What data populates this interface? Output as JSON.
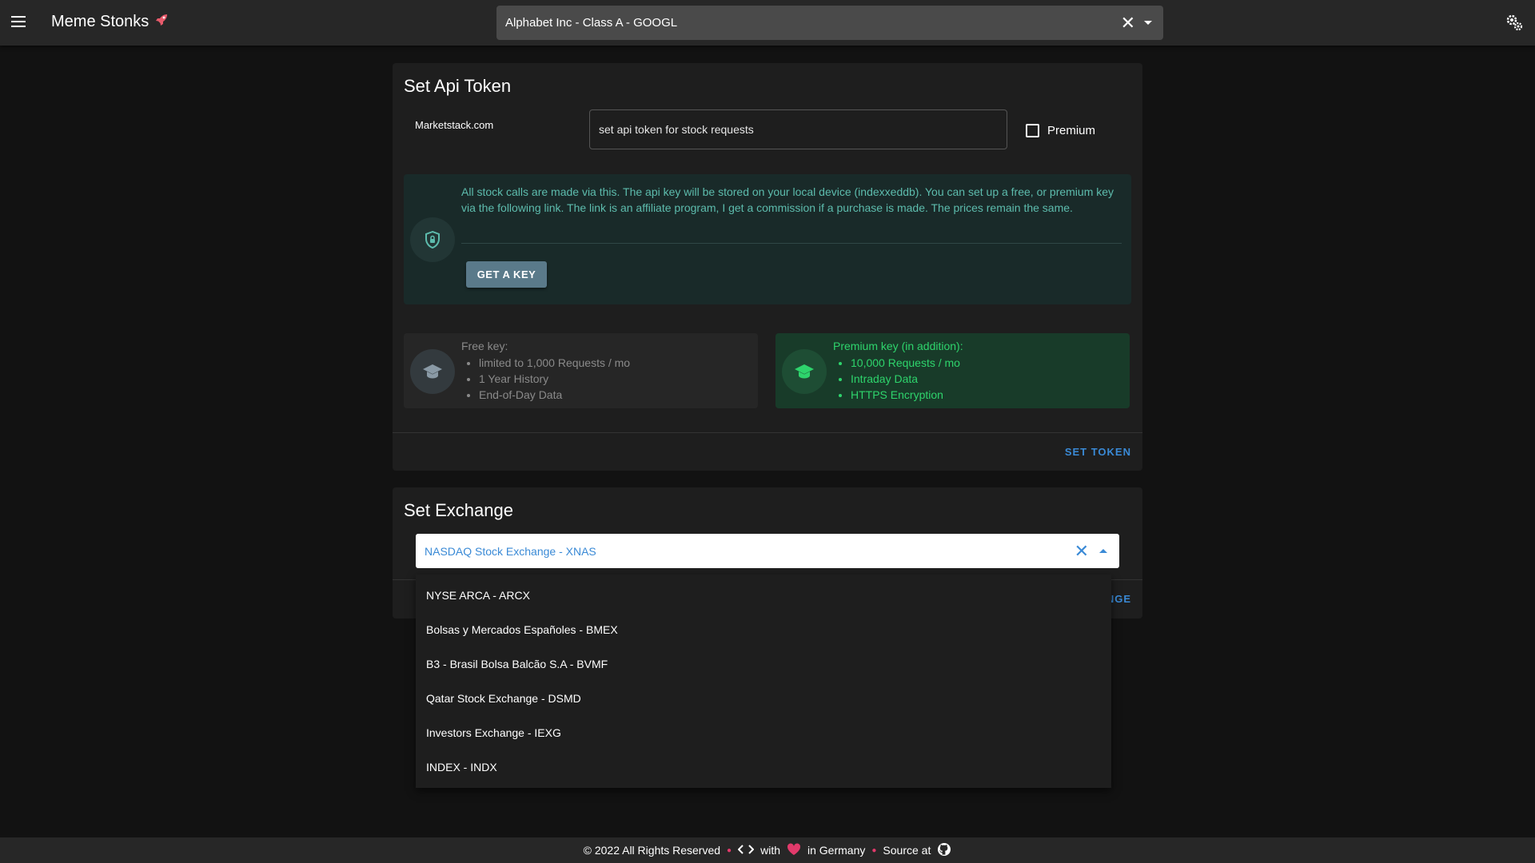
{
  "appbar": {
    "title": "Meme Stonks",
    "stock_select_value": "Alphabet Inc - Class A - GOOGL"
  },
  "api_card": {
    "title": "Set Api Token",
    "provider_label": "Marketstack.com",
    "token_placeholder": "set api token for stock requests",
    "premium_label": "Premium",
    "info_text": "All stock calls are made via this. The api key will be stored on your local device (indexxeddb). You can set up a free, or premium key via the following link. The link is an affiliate program, I get a commission if a purchase is made. The prices remain the same.",
    "get_key_label": "GET A KEY",
    "free_title": "Free key:",
    "free_items": [
      "limited to 1,000 Requests / mo",
      "1 Year History",
      "End-of-Day Data"
    ],
    "premium_title": "Premium key (in addition):",
    "premium_items": [
      "10,000 Requests / mo",
      "Intraday Data",
      "HTTPS Encryption"
    ],
    "set_token_label": "SET TOKEN"
  },
  "exchange_card": {
    "title": "Set Exchange",
    "selected": "NASDAQ Stock Exchange - XNAS",
    "set_exchange_label": "NGE",
    "options": [
      "NYSE ARCA - ARCX",
      "Bolsas y Mercados Españoles - BMEX",
      "B3 - Brasil Bolsa Balcão S.A - BVMF",
      "Qatar Stock Exchange - DSMD",
      "Investors Exchange - IEXG",
      "INDEX - INDX"
    ]
  },
  "footer": {
    "copyright": "© 2022 All Rights Reserved",
    "with": "with",
    "in_germany": "in Germany",
    "source": "Source at"
  },
  "colors": {
    "accent": "#3a8ad6",
    "info_text": "#5dbcad",
    "premium_green": "#2ed46c",
    "heart": "#e23a6b"
  }
}
